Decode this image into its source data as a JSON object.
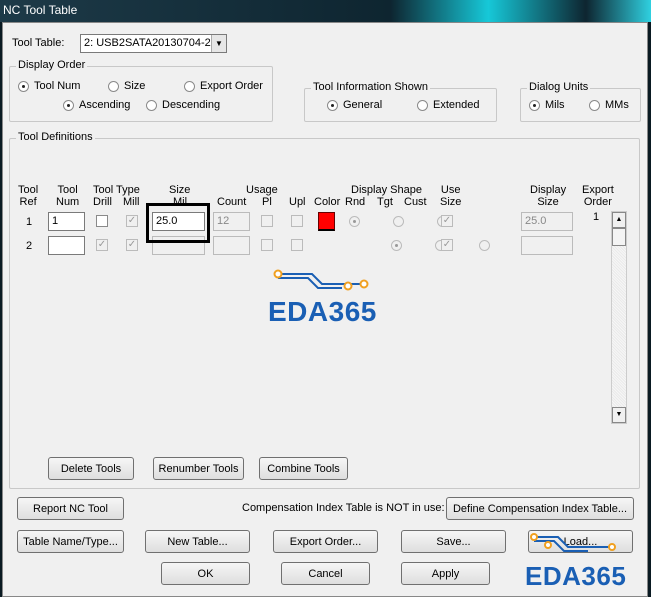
{
  "window": {
    "title": "NC Tool Table"
  },
  "tool_table": {
    "label": "Tool Table:",
    "value": "2: USB2SATA20130704-2"
  },
  "display_order": {
    "title": "Display Order",
    "options": [
      "Tool Num",
      "Size",
      "Export Order"
    ],
    "selected": "Tool Num",
    "direction": [
      "Ascending",
      "Descending"
    ],
    "direction_selected": "Ascending"
  },
  "tool_info": {
    "title": "Tool Information Shown",
    "options": [
      "General",
      "Extended"
    ],
    "selected": "General"
  },
  "units": {
    "title": "Dialog Units",
    "options": [
      "Mils",
      "MMs"
    ],
    "selected": "Mils"
  },
  "defs": {
    "title": "Tool Definitions",
    "headers": {
      "tool_ref": "Tool\nRef",
      "tool_num": "Tool\nNum",
      "tool_type": "Tool Type",
      "drill": "Drill",
      "mill": "Mill",
      "size": "Size",
      "mil": "Mil",
      "usage": "Usage",
      "count": "Count",
      "pl": "Pl",
      "upl": "Upl",
      "color": "Color",
      "display_shape": "Display Shape",
      "rnd": "Rnd",
      "tgt": "Tgt",
      "cust": "Cust",
      "use_size": "Use\nSize",
      "display_size": "Display\nSize",
      "export_order": "Export\nOrder"
    },
    "rows": [
      {
        "ref": "1",
        "num": "1",
        "drill": false,
        "mill": true,
        "size": "25.0",
        "count": "12",
        "pl": false,
        "upl": false,
        "color": "#ff0000",
        "shape": "Rnd",
        "use_size": true,
        "display_size": "25.0",
        "export_order": "1"
      },
      {
        "ref": "2",
        "num": "",
        "drill": true,
        "mill": true,
        "size": "",
        "count": "",
        "pl": false,
        "upl": false,
        "color": "",
        "shape": "Rnd",
        "use_size": true,
        "display_size": "",
        "export_order": ""
      }
    ],
    "buttons": {
      "delete": "Delete Tools",
      "renumber": "Renumber Tools",
      "combine": "Combine Tools"
    }
  },
  "compensation": {
    "report": "Report NC Tool",
    "status": "Compensation Index Table is NOT in use:",
    "define": "Define Compensation Index Table..."
  },
  "actions": {
    "table_name": "Table Name/Type...",
    "new_table": "New Table...",
    "export_order": "Export Order...",
    "save": "Save...",
    "load": "Load...",
    "ok": "OK",
    "cancel": "Cancel",
    "apply": "Apply"
  },
  "watermark": "EDA365"
}
